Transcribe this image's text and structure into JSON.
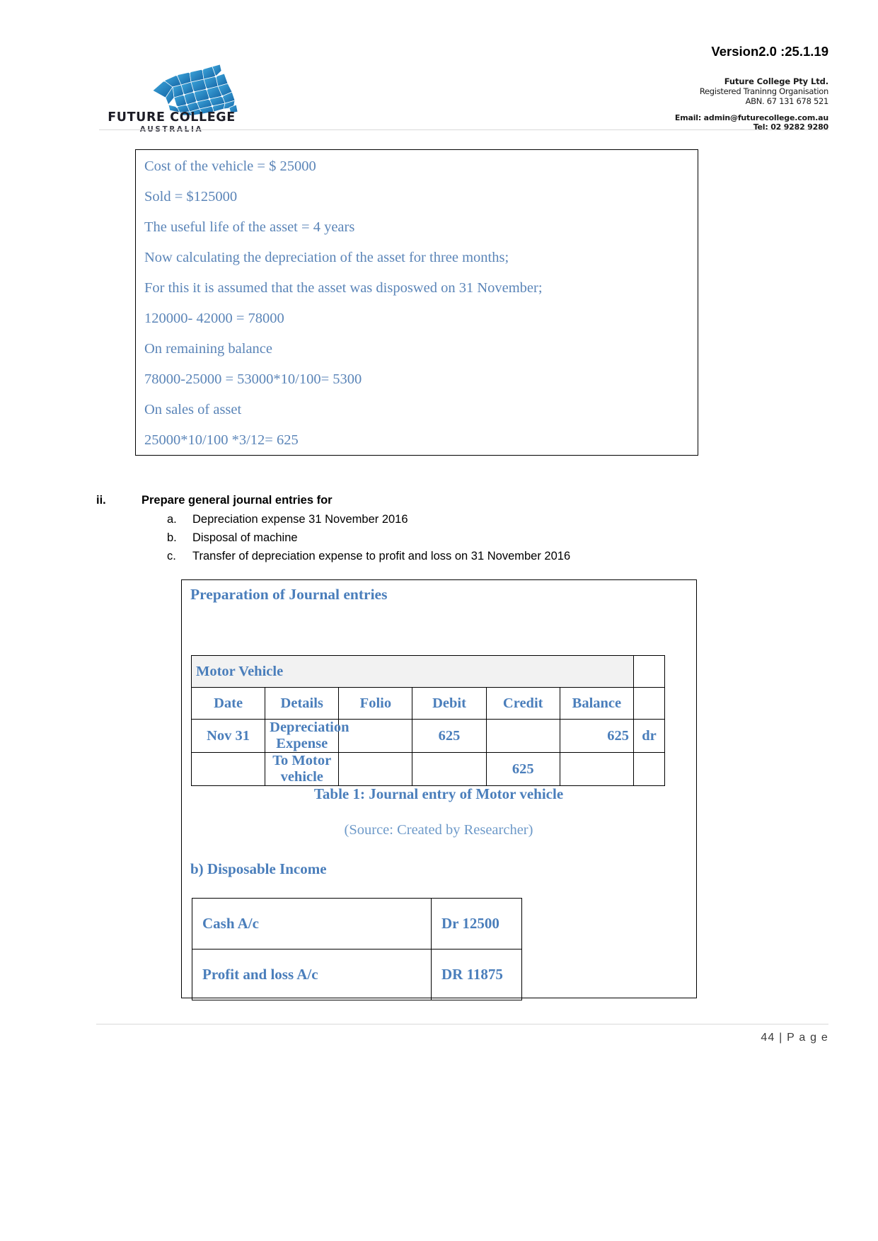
{
  "header": {
    "version": "Version2.0 :25.1.19",
    "org_name": "Future College Pty Ltd.",
    "org_rto": "Registered Traninng Organisation",
    "org_abn": "ABN. 67 131 678 521",
    "org_email": "Email: admin@futurecollege.com.au",
    "org_tel": "Tel: 02 9282 9280",
    "logo_text": "FUTURE COLLEGE",
    "logo_sub": "AUSTRALIA"
  },
  "calc_box": {
    "lines": [
      "Cost of the vehicle = $ 25000",
      "Sold = $125000",
      "The useful life of the asset = 4 years",
      "Now calculating the depreciation of the asset for three months;",
      "For this it is assumed that the asset was disposwed on 31 November;",
      "120000- 42000 = 78000",
      "On remaining balance",
      "78000-25000 = 53000*10/100= 5300",
      "On sales of asset",
      "25000*10/100 *3/12= 625"
    ]
  },
  "section_ii": {
    "numeral": "ii.",
    "heading": "Prepare general journal entries  for",
    "items": [
      {
        "marker": "a.",
        "text": "Depreciation expense 31 November 2016"
      },
      {
        "marker": "b.",
        "text": "Disposal of machine"
      },
      {
        "marker": "c.",
        "text": "Transfer of depreciation expense to profit and loss on 31 November 2016"
      }
    ]
  },
  "journal_box": {
    "title": "Preparation of Journal entries",
    "account_name": "Motor Vehicle",
    "columns": [
      "Date",
      "Details",
      "Folio",
      "Debit",
      "Credit",
      "Balance"
    ],
    "rows": [
      {
        "date": "Nov 31",
        "details": "Depreciation Expense",
        "folio": "",
        "debit": "625",
        "credit": "",
        "balance": "625",
        "dr": "dr"
      },
      {
        "date": "",
        "details": "To Motor vehicle",
        "folio": "",
        "debit": "",
        "credit": "625",
        "balance": "",
        "dr": ""
      }
    ],
    "caption": "Table 1: Journal entry of Motor vehicle",
    "source": "(Source: Created by Researcher)",
    "sub_heading_b": "b) Disposable Income",
    "disposable_rows": [
      {
        "label": "Cash A/c",
        "value": "Dr 12500"
      },
      {
        "label": "Profit and loss A/c",
        "value": "DR 11875"
      }
    ]
  },
  "footer": {
    "page_label": "44 |  P a g e"
  },
  "colors": {
    "accent_blue": "#4a7ebb",
    "body_blue": "#5b85b8",
    "source_blue": "#6e9ac9",
    "header_fill": "#f2f2f2"
  }
}
